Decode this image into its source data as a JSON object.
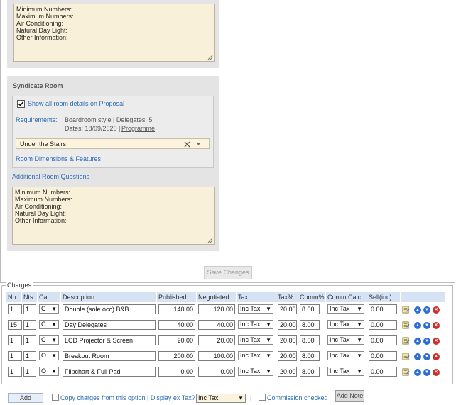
{
  "top_panel": {
    "textarea_lines": [
      "Minimum Numbers:",
      "Maximum Numbers:",
      "Air Conditioning:",
      "Natural Day Light:",
      "Other Information:"
    ]
  },
  "syndicate": {
    "title": "Syndicate Room",
    "show_details_label": "Show all room details on Proposal",
    "requirements_label": "Requirements:",
    "requirements_value": "Boardroom style | Delegates: 5",
    "dates_label": "Dates: 18/09/2020 |",
    "programme_link": "Programme",
    "room_select_value": "Under the Stairs",
    "room_dims_link": "Room Dimensions & Features",
    "additional_questions": "Additional Room Questions",
    "textarea_lines": [
      "Minimum Numbers:",
      "Maximum Numbers:",
      "Air Conditioning:",
      "Natural Day Light:",
      "Other Information:"
    ]
  },
  "save_changes": "Save Changes",
  "charges": {
    "legend": "Charges",
    "headers": [
      "No",
      "Nts",
      "Cat",
      "Description",
      "Published",
      "Negotiated",
      "Tax",
      "Tax%",
      "Comm%",
      "Comm Calc",
      "Sell(inc)"
    ],
    "rows": [
      {
        "no": "1",
        "nts": "1",
        "cat": "C",
        "description": "Double (sole occ) B&B",
        "published": "140.00",
        "negotiated": "120.00",
        "tax": "Inc Tax",
        "tax_pct": "20.00",
        "comm_pct": "8.00",
        "comm_calc": "Inc Tax",
        "sell": "0.00"
      },
      {
        "no": "15",
        "nts": "1",
        "cat": "C",
        "description": "Day Delegates",
        "published": "40.00",
        "negotiated": "40.00",
        "tax": "Inc Tax",
        "tax_pct": "20.00",
        "comm_pct": "8.00",
        "comm_calc": "Inc Tax",
        "sell": "0.00"
      },
      {
        "no": "1",
        "nts": "1",
        "cat": "C",
        "description": "LCD Projector & Screen",
        "published": "20.00",
        "negotiated": "20.00",
        "tax": "Inc Tax",
        "tax_pct": "20.00",
        "comm_pct": "8.00",
        "comm_calc": "Inc Tax",
        "sell": "0.00"
      },
      {
        "no": "1",
        "nts": "1",
        "cat": "O",
        "description": "Breakout Room",
        "published": "200.00",
        "negotiated": "100.00",
        "tax": "Inc Tax",
        "tax_pct": "20.00",
        "comm_pct": "8.00",
        "comm_calc": "Inc Tax",
        "sell": "0.00"
      },
      {
        "no": "1",
        "nts": "1",
        "cat": "O",
        "description": "Flipchart & Full Pad",
        "published": "0.00",
        "negotiated": "0.00",
        "tax": "Inc Tax",
        "tax_pct": "20.00",
        "comm_pct": "8.00",
        "comm_calc": "Inc Tax",
        "sell": "0.00"
      }
    ]
  },
  "footer": {
    "add_button": "Add",
    "copy_charges": "Copy charges from this option | Display ex Tax?",
    "tax_select": "Inc Tax",
    "separator": "|",
    "commission_checked": "Commission checked",
    "add_note": "Add Note"
  },
  "colors": {
    "link_blue": "#2a6bb5",
    "header_blue": "#d5e3f4",
    "textarea_yellow": "#f8f0d8",
    "panel_grey": "#e4e4e4"
  }
}
